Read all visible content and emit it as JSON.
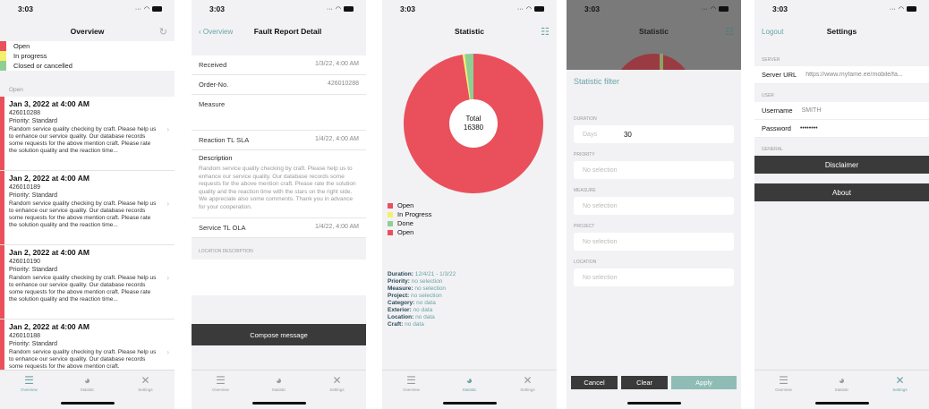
{
  "time": "3:03",
  "colors": {
    "open": "#e9505c",
    "in_progress": "#f5f06a",
    "done": "#8fcf95",
    "accent": "#6aa3a3",
    "dark": "#3a3a3a"
  },
  "tabbar": {
    "overview": "Overview",
    "statistic": "Statistic",
    "settings": "Settings"
  },
  "overview": {
    "title": "Overview",
    "legend": [
      "Open",
      "In progress",
      "Closed or cancelled"
    ],
    "section": "Open",
    "reports": [
      {
        "date": "Jan 3, 2022 at 4:00 AM",
        "number": "426010288",
        "priority": "Priority: Standard",
        "text": "Random service quality checking by craft. Please help us to enhance our service quality. Our database records some requests for the above mention craft. Please rate the solution quality and the reaction time..."
      },
      {
        "date": "Jan 2, 2022 at 4:00 AM",
        "number": "426010189",
        "priority": "Priority: Standard",
        "text": "Random service quality checking by craft. Please help us to enhance our service quality. Our database records some requests for the above mention craft. Please rate the solution quality and the reaction time..."
      },
      {
        "date": "Jan 2, 2022 at 4:00 AM",
        "number": "426010190",
        "priority": "Priority: Standard",
        "text": "Random service quality checking by craft. Please help us to enhance our service quality. Our database records some requests for the above mention craft. Please rate the solution quality and the reaction time..."
      },
      {
        "date": "Jan 2, 2022 at 4:00 AM",
        "number": "426010188",
        "priority": "Priority: Standard",
        "text": "Random service quality checking by craft. Please help us to enhance our service quality. Our database records some requests for the above mention craft."
      }
    ]
  },
  "detail": {
    "back": "Overview",
    "title": "Fault Report Detail",
    "received_label": "Received",
    "received_value": "1/3/22, 4:00 AM",
    "order_label": "Order-No.",
    "order_value": "426010288",
    "measure_label": "Measure",
    "reaction_label": "Reaction TL SLA",
    "reaction_value": "1/4/22, 4:00 AM",
    "description_label": "Description",
    "description_text": "Random service quality checking by craft. Please help us to enhance our service quality. Our database records some requests for the above mention craft. Please rate the solution quality and the reaction time with the stars on the right side. We appreciate also some comments. Thank you in advance for your cooperation.",
    "service_label": "Service TL OLA",
    "service_value": "1/4/22, 4:00 AM",
    "location_label": "LOCATION DESCRIPTION",
    "compose": "Compose message"
  },
  "statistic": {
    "title": "Statistic",
    "total_label": "Total",
    "total_value": "16380",
    "legend": [
      "Open",
      "In Progress",
      "Done",
      "Open"
    ],
    "duration_label": "Duration:",
    "duration_value": "12/4/21 - 1/3/22",
    "summary": [
      {
        "k": "Priority:",
        "v": "no selection"
      },
      {
        "k": "Measure:",
        "v": "no selection"
      },
      {
        "k": "Project:",
        "v": "no selection"
      },
      {
        "k": "Category:",
        "v": "no data"
      },
      {
        "k": "Exterior:",
        "v": "no data"
      },
      {
        "k": "Location:",
        "v": "no data"
      },
      {
        "k": "Craft:",
        "v": "no data"
      }
    ]
  },
  "chart_data": {
    "type": "pie",
    "title": "",
    "center_label": "Total",
    "center_value": 16380,
    "slices": [
      {
        "name": "Open",
        "fraction": 0.975,
        "color": "#e9505c"
      },
      {
        "name": "In Progress",
        "fraction": 0.005,
        "color": "#f5f06a"
      },
      {
        "name": "Done",
        "fraction": 0.02,
        "color": "#8fcf95"
      }
    ]
  },
  "filter": {
    "title": "Statistic filter",
    "duration_label": "DURATION",
    "days_label": "Days",
    "days_value": "30",
    "priority_label": "PRIORITY",
    "measure_label": "MEASURE",
    "project_label": "PROJECT",
    "location_label": "LOCATION",
    "no_selection": "No selection",
    "cancel": "Cancel",
    "clear": "Clear",
    "apply": "Apply"
  },
  "settings": {
    "logout": "Logout",
    "title": "Settings",
    "server_label": "SERVER",
    "server_url_label": "Server URL",
    "server_url_value": "https://www.myfame.ee/mobile/fa...",
    "user_label": "USER",
    "username_label": "Username",
    "username_value": "SMITH",
    "password_label": "Password",
    "password_value": "••••••••",
    "general_label": "GENERAL",
    "disclaimer": "Disclaimer",
    "about": "About"
  }
}
